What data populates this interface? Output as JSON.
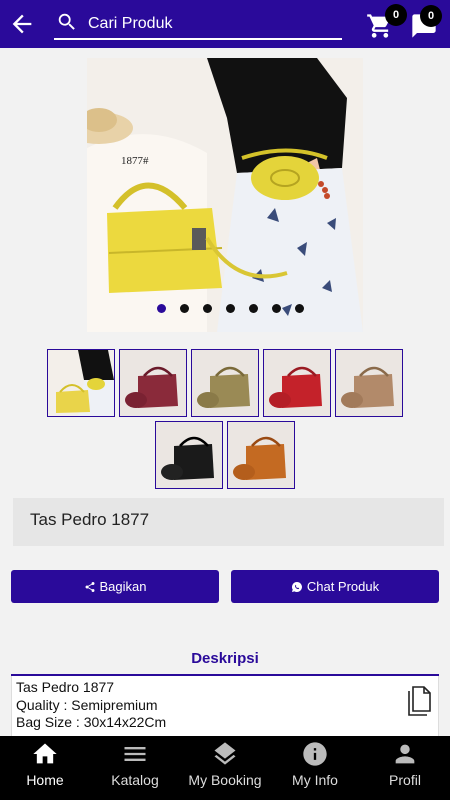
{
  "header": {
    "search_placeholder": "Cari Produk",
    "cart_count": "0",
    "chat_count": "0"
  },
  "product": {
    "image_code": "1877#",
    "title": "Tas Pedro 1877",
    "slide_count": 7,
    "active_slide": 1,
    "thumbnails": [
      {
        "color": "#e9d44a",
        "alt": "yellow"
      },
      {
        "color": "#8a2a3a",
        "alt": "maroon"
      },
      {
        "color": "#9a8a55",
        "alt": "khaki"
      },
      {
        "color": "#c4222a",
        "alt": "red"
      },
      {
        "color": "#b28a6a",
        "alt": "tan"
      },
      {
        "color": "#1a1a1a",
        "alt": "black"
      },
      {
        "color": "#c46a22",
        "alt": "orange"
      }
    ]
  },
  "actions": {
    "share_label": "Bagikan",
    "chat_label": "Chat Produk"
  },
  "description": {
    "heading": "Deskripsi",
    "text": "Tas Pedro 1877\nQuality : Semipremium\nBag Size : 30x14x22Cm"
  },
  "nav": {
    "items": [
      {
        "label": "Home",
        "icon": "home-icon",
        "active": true
      },
      {
        "label": "Katalog",
        "icon": "menu-icon",
        "active": false
      },
      {
        "label": "My Booking",
        "icon": "layers-icon",
        "active": false
      },
      {
        "label": "My Info",
        "icon": "info-icon",
        "active": false
      },
      {
        "label": "Profil",
        "icon": "person-icon",
        "active": false
      }
    ]
  },
  "colors": {
    "brand": "#2a0a9a",
    "nav_bg": "#000000"
  }
}
